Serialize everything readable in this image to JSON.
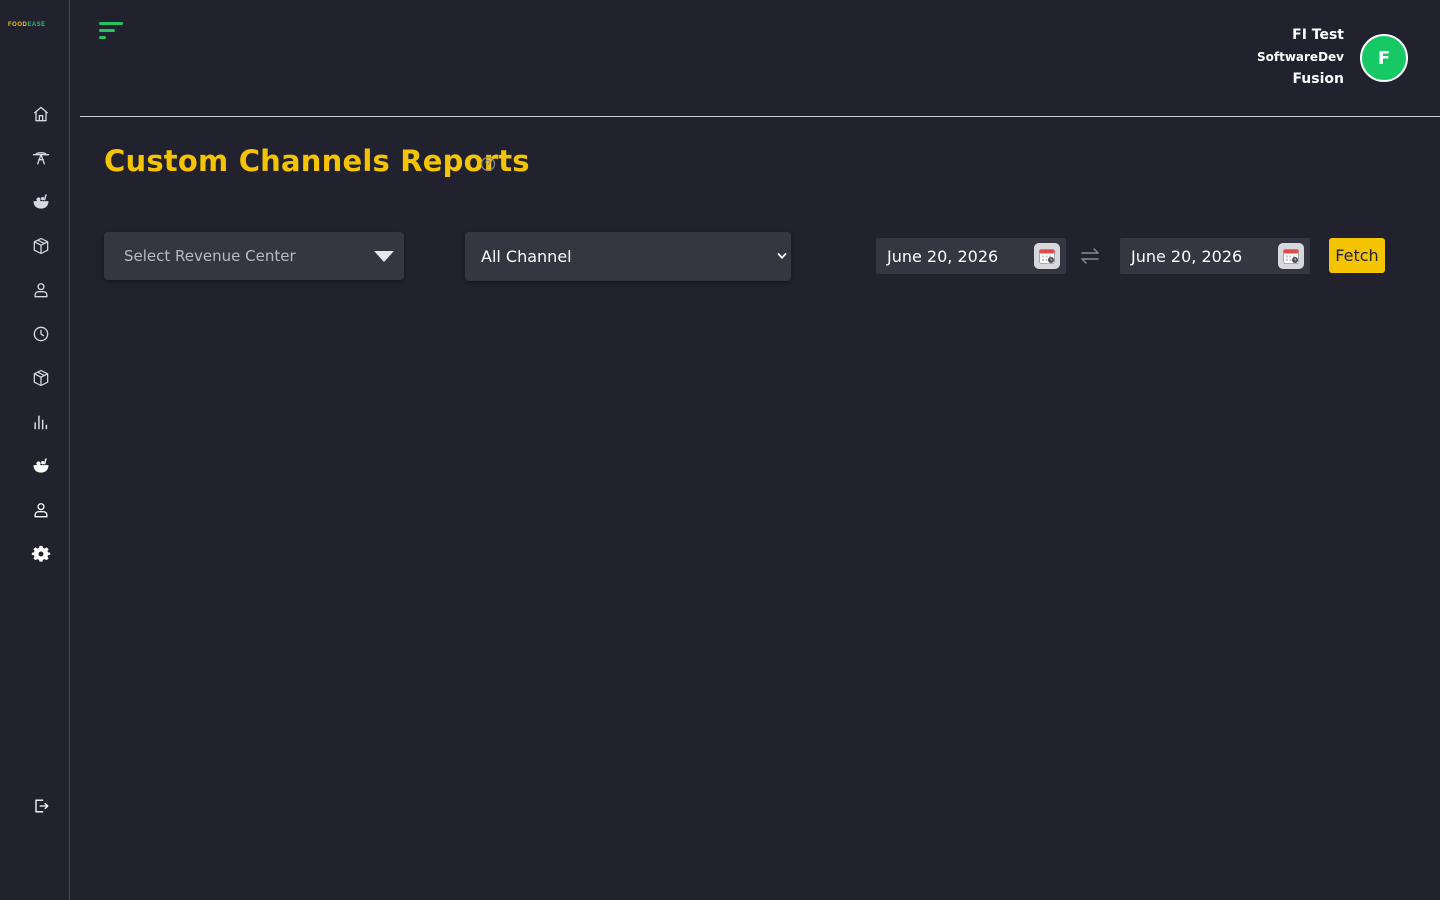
{
  "app": {
    "logo_part1": "FOOD",
    "logo_part2": "EASE"
  },
  "sidebar": {
    "items": [
      {
        "name": "home-icon"
      },
      {
        "name": "service-bell-icon"
      },
      {
        "name": "food-bowl-icon"
      },
      {
        "name": "package-box-icon"
      },
      {
        "name": "user-icon"
      },
      {
        "name": "clock-icon"
      },
      {
        "name": "package-box-icon"
      },
      {
        "name": "bar-chart-icon"
      },
      {
        "name": "food-bowl-icon"
      },
      {
        "name": "user-icon"
      },
      {
        "name": "gear-icon"
      }
    ],
    "logout_icon": "logout-icon"
  },
  "user": {
    "line1": "FI Test",
    "line2": "SoftwareDev",
    "line3": "Fusion",
    "avatar_initial": "F"
  },
  "page": {
    "title": "Custom Channels Reports"
  },
  "filters": {
    "revenue_center_placeholder": "Select Revenue Center",
    "channel_selected": "All Channel",
    "start_date": "June 20, 2026",
    "end_date": "June 20, 2026",
    "fetch_label": "Fetch"
  },
  "colors": {
    "background": "#22222e",
    "accent_yellow": "#f5c400",
    "accent_green": "#17c964",
    "input_bg": "#363643"
  }
}
